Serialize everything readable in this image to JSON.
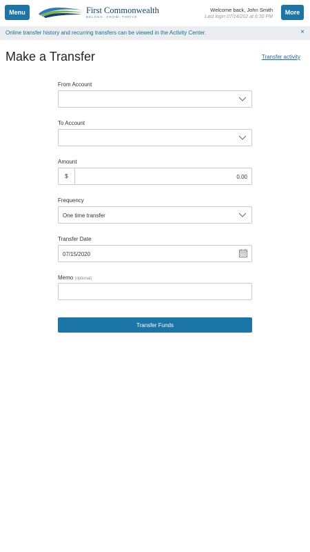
{
  "header": {
    "menu_label": "Menu",
    "more_label": "More",
    "logo_name": "First Commonwealth",
    "logo_tagline": "BELONG. GROW. THRIVE.",
    "welcome": "Welcome back, John Smith",
    "last_login": "Last login 07/14/202 at 6:30 PM"
  },
  "banner": {
    "text": "Online transfer history and recurring transfers can be viewed in the Activity Center.",
    "close_icon": "×"
  },
  "page": {
    "title": "Make a Transfer",
    "activity_link": "Transfer activity"
  },
  "form": {
    "from_label": "From Account",
    "from_value": "",
    "to_label": "To Account",
    "to_value": "",
    "amount_label": "Amount",
    "currency_symbol": "$",
    "amount_value": "0.00",
    "frequency_label": "Frequency",
    "frequency_value": "One time transfer",
    "date_label": "Transfer Date",
    "date_value": "07/15/2020",
    "memo_label": "Memo",
    "memo_optional": "(optional)",
    "memo_value": "",
    "submit_label": "Transfer Funds"
  },
  "icons": {
    "dropdown": "chevron-down-icon",
    "calendar": "calendar-icon",
    "close": "close-icon"
  },
  "colors": {
    "brand_blue": "#1b75a6",
    "link_blue": "#1b6b96",
    "banner_bg": "#eaeef1"
  }
}
